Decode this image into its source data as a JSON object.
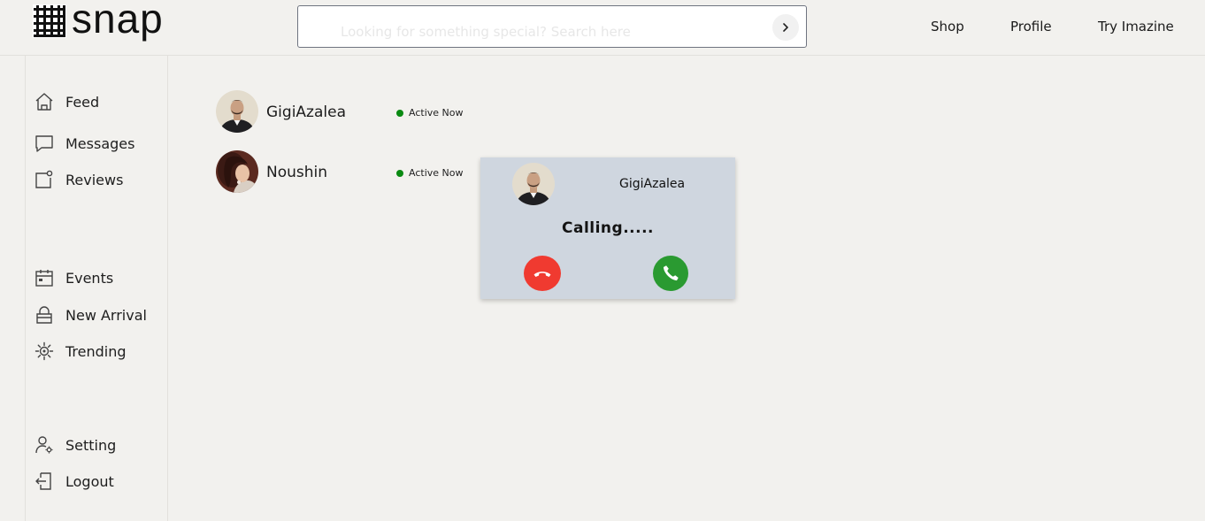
{
  "header": {
    "logo_text": "snap",
    "search": {
      "placeholder": "Looking for something special? Search here",
      "value": ""
    },
    "nav": [
      {
        "label": "Shop"
      },
      {
        "label": "Profile"
      },
      {
        "label": "Try Imazine"
      }
    ]
  },
  "sidebar": {
    "items": [
      {
        "label": "Feed",
        "icon": "home-icon"
      },
      {
        "label": "Messages",
        "icon": "message-icon"
      },
      {
        "label": "Reviews",
        "icon": "review-icon"
      },
      {
        "label": "Events",
        "icon": "calendar-icon"
      },
      {
        "label": "New Arrival",
        "icon": "bag-icon"
      },
      {
        "label": "Trending",
        "icon": "trending-icon"
      },
      {
        "label": "Setting",
        "icon": "user-settings-icon"
      },
      {
        "label": "Logout",
        "icon": "logout-icon"
      }
    ]
  },
  "contacts": [
    {
      "name": "GigiAzalea",
      "status": "Active Now"
    },
    {
      "name": "Noushin",
      "status": "Active Now"
    }
  ],
  "call": {
    "name": "GigiAzalea",
    "status": "Calling.....",
    "decline_color": "#f03a30",
    "accept_color": "#2a9a31"
  },
  "colors": {
    "background": "#f2f1ee",
    "active_dot": "#0a8a12",
    "call_card": "#cfd6df"
  }
}
